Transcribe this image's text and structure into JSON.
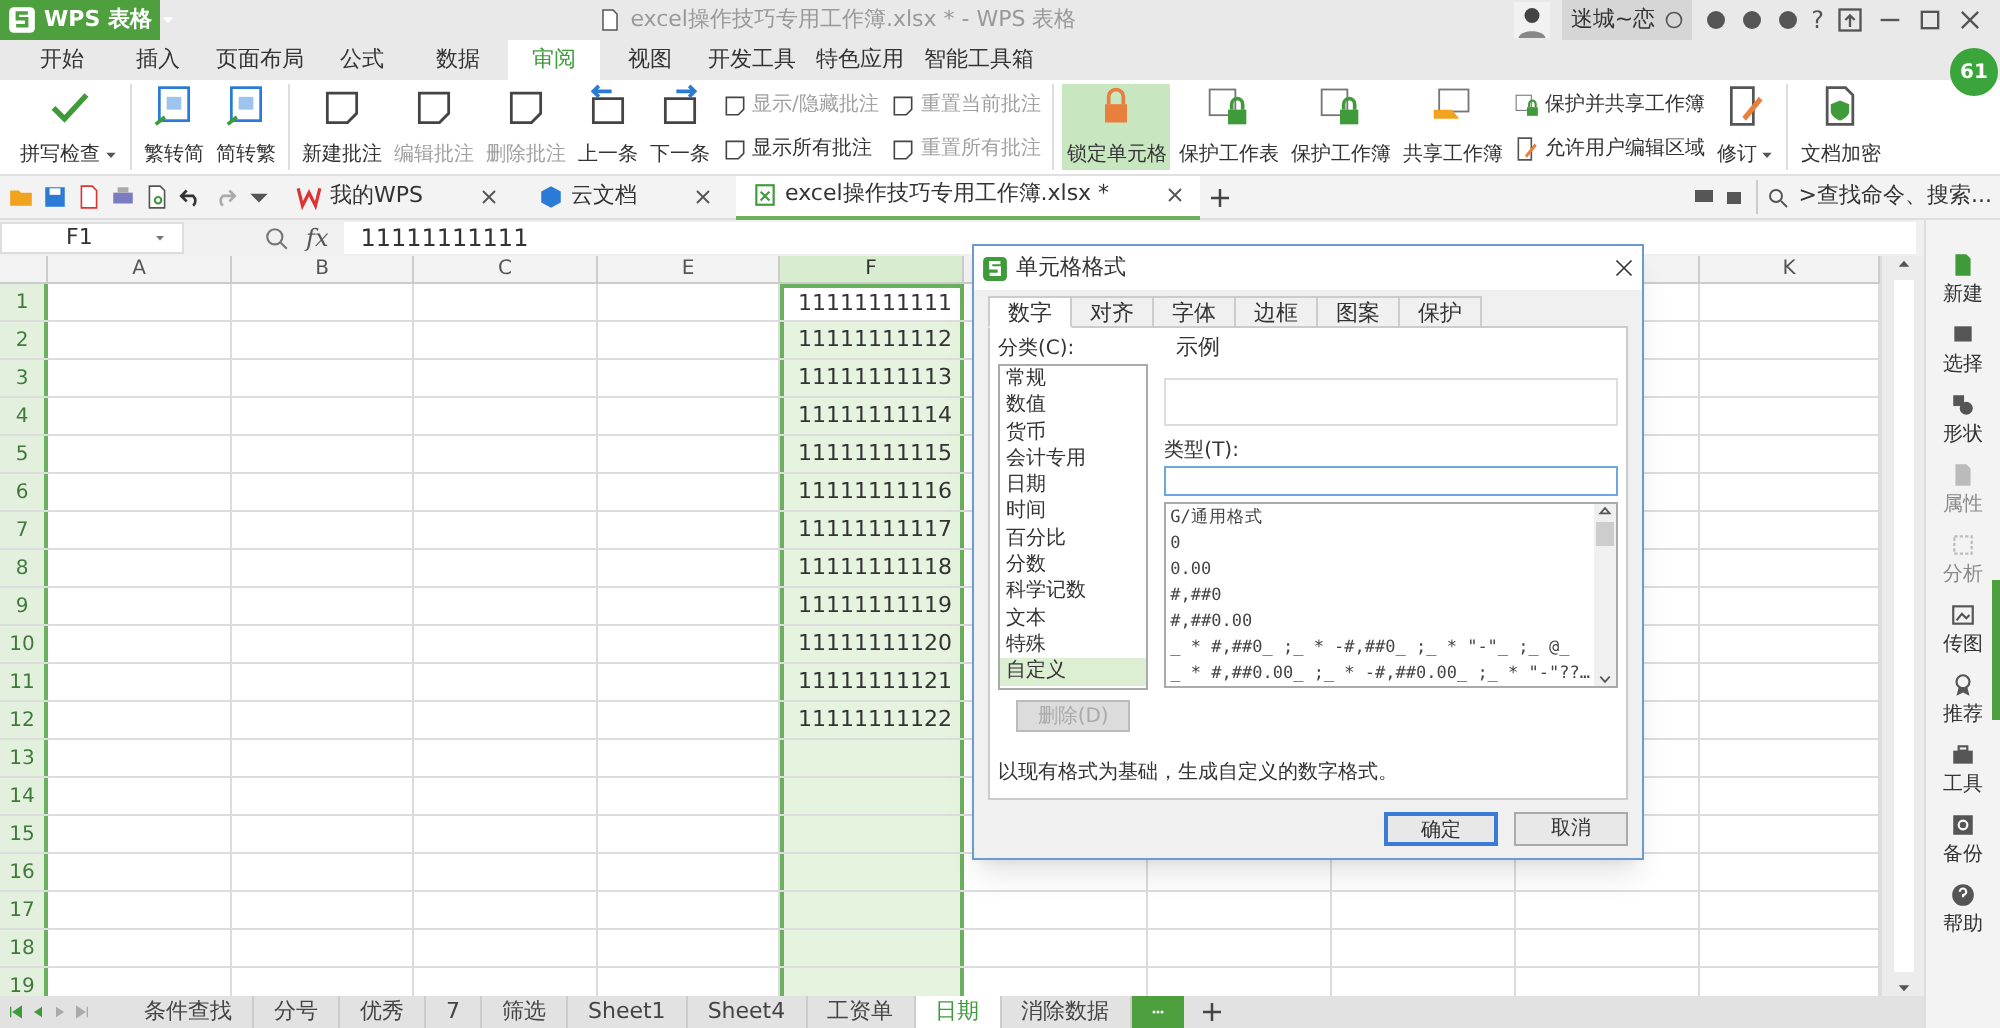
{
  "app_button": {
    "label": "WPS 表格"
  },
  "window": {
    "title": "excel操作技巧专用工作簿.xlsx * - WPS 表格"
  },
  "user": {
    "name": "迷城~恋",
    "help": "?"
  },
  "badge": {
    "text": "61"
  },
  "ribbon_tabs": [
    {
      "label": "开始",
      "selected": false
    },
    {
      "label": "插入",
      "selected": false
    },
    {
      "label": "页面布局",
      "selected": false
    },
    {
      "label": "公式",
      "selected": false
    },
    {
      "label": "数据",
      "selected": false
    },
    {
      "label": "审阅",
      "selected": true
    },
    {
      "label": "视图",
      "selected": false
    },
    {
      "label": "开发工具",
      "selected": false
    },
    {
      "label": "特色应用",
      "selected": false
    },
    {
      "label": "智能工具箱",
      "selected": false
    }
  ],
  "ribbon_groups": [
    {
      "items": [
        {
          "kind": "large",
          "label": "拼写检查",
          "dropdown": true,
          "disabled": false,
          "selected": false
        }
      ]
    },
    {
      "items": [
        {
          "kind": "large",
          "label": "繁转简",
          "disabled": false,
          "selected": false
        },
        {
          "kind": "large",
          "label": "简转繁",
          "disabled": false,
          "selected": false
        }
      ]
    },
    {
      "items": [
        {
          "kind": "large",
          "label": "新建批注",
          "disabled": false,
          "selected": false
        },
        {
          "kind": "large",
          "label": "编辑批注",
          "disabled": true,
          "selected": false
        },
        {
          "kind": "large",
          "label": "删除批注",
          "disabled": true,
          "selected": false
        },
        {
          "kind": "large",
          "label": "上一条",
          "disabled": false,
          "selected": false
        },
        {
          "kind": "large",
          "label": "下一条",
          "disabled": false,
          "selected": false
        },
        {
          "kind": "small",
          "label": "显示/隐藏批注",
          "disabled": true,
          "selected": false
        },
        {
          "kind": "small",
          "label": "显示所有批注",
          "disabled": false,
          "selected": false
        },
        {
          "kind": "small",
          "label": "重置当前批注",
          "disabled": true,
          "selected": false
        },
        {
          "kind": "small",
          "label": "重置所有批注",
          "disabled": true,
          "selected": false
        }
      ]
    },
    {
      "items": [
        {
          "kind": "large",
          "label": "锁定单元格",
          "disabled": false,
          "selected": true
        },
        {
          "kind": "large",
          "label": "保护工作表",
          "disabled": false,
          "selected": false
        },
        {
          "kind": "large",
          "label": "保护工作簿",
          "disabled": false,
          "selected": false
        },
        {
          "kind": "large",
          "label": "共享工作簿",
          "disabled": false,
          "selected": false
        },
        {
          "kind": "small",
          "label": "保护并共享工作簿",
          "disabled": false,
          "selected": false
        },
        {
          "kind": "small",
          "label": "允许用户编辑区域",
          "disabled": false,
          "selected": false
        },
        {
          "kind": "large",
          "label": "修订",
          "dropdown": true,
          "disabled": false,
          "selected": false
        }
      ]
    },
    {
      "items": [
        {
          "kind": "large",
          "label": "文档加密",
          "disabled": false,
          "selected": false
        }
      ]
    }
  ],
  "doc_tabs": [
    {
      "label": "我的WPS",
      "selected": false
    },
    {
      "label": "云文档",
      "selected": false
    },
    {
      "label": "excel操作技巧专用工作簿.xlsx *",
      "selected": true
    }
  ],
  "search": {
    "placeholder": ">查找命令、搜索..."
  },
  "formula_bar": {
    "name_box": "F1",
    "fx": "fx",
    "value": "11111111111"
  },
  "columns": [
    {
      "label": "A",
      "selected": false
    },
    {
      "label": "B",
      "selected": false
    },
    {
      "label": "C",
      "selected": false
    },
    {
      "label": "E",
      "selected": false
    },
    {
      "label": "F",
      "selected": true
    },
    {
      "label": "K",
      "selected": false
    }
  ],
  "rows": [
    {
      "header": "1",
      "column_f": "11111111111"
    },
    {
      "header": "2",
      "column_f": "11111111112"
    },
    {
      "header": "3",
      "column_f": "11111111113"
    },
    {
      "header": "4",
      "column_f": "11111111114"
    },
    {
      "header": "5",
      "column_f": "11111111115"
    },
    {
      "header": "6",
      "column_f": "11111111116"
    },
    {
      "header": "7",
      "column_f": "11111111117"
    },
    {
      "header": "8",
      "column_f": "11111111118"
    },
    {
      "header": "9",
      "column_f": "11111111119"
    },
    {
      "header": "10",
      "column_f": "11111111120"
    },
    {
      "header": "11",
      "column_f": "11111111121"
    },
    {
      "header": "12",
      "column_f": "11111111122"
    },
    {
      "header": "13"
    },
    {
      "header": "14"
    },
    {
      "header": "15"
    },
    {
      "header": "16"
    },
    {
      "header": "17"
    },
    {
      "header": "18"
    },
    {
      "header": "19"
    }
  ],
  "sheet_tabs": [
    {
      "label": "条件查找",
      "selected": false
    },
    {
      "label": "分号",
      "selected": false
    },
    {
      "label": "优秀",
      "selected": false
    },
    {
      "label": "7",
      "selected": false
    },
    {
      "label": "筛选",
      "selected": false
    },
    {
      "label": "Sheet1",
      "selected": false
    },
    {
      "label": "Sheet4",
      "selected": false
    },
    {
      "label": "工资单",
      "selected": false
    },
    {
      "label": "日期",
      "selected": true
    },
    {
      "label": "消除数据",
      "selected": false
    }
  ],
  "sidebar": [
    {
      "label": "新建",
      "disabled": false
    },
    {
      "label": "选择",
      "disabled": false
    },
    {
      "label": "形状",
      "disabled": false
    },
    {
      "label": "属性",
      "disabled": true
    },
    {
      "label": "分析",
      "disabled": true
    },
    {
      "label": "传图",
      "disabled": false
    },
    {
      "label": "推荐",
      "disabled": false
    },
    {
      "label": "工具",
      "disabled": false
    },
    {
      "label": "备份",
      "disabled": false
    },
    {
      "label": "帮助",
      "disabled": false
    }
  ],
  "dialog": {
    "title": "单元格格式",
    "tabs": [
      {
        "label": "数字",
        "selected": true
      },
      {
        "label": "对齐",
        "selected": false
      },
      {
        "label": "字体",
        "selected": false
      },
      {
        "label": "边框",
        "selected": false
      },
      {
        "label": "图案",
        "selected": false
      },
      {
        "label": "保护",
        "selected": false
      }
    ],
    "category_label": "分类(C):",
    "categories": [
      {
        "label": "常规",
        "selected": false
      },
      {
        "label": "数值",
        "selected": false
      },
      {
        "label": "货币",
        "selected": false
      },
      {
        "label": "会计专用",
        "selected": false
      },
      {
        "label": "日期",
        "selected": false
      },
      {
        "label": "时间",
        "selected": false
      },
      {
        "label": "百分比",
        "selected": false
      },
      {
        "label": "分数",
        "selected": false
      },
      {
        "label": "科学记数",
        "selected": false
      },
      {
        "label": "文本",
        "selected": false
      },
      {
        "label": "特殊",
        "selected": false
      },
      {
        "label": "自定义",
        "selected": true
      }
    ],
    "delete_button": {
      "label": "删除(D)",
      "disabled": true
    },
    "sample_label": "示例",
    "type_label": "类型(T):",
    "type_formats": [
      "G/通用格式",
      "0",
      "0.00",
      "#,##0",
      "#,##0.00",
      "_ * #,##0_ ;_ * -#,##0_ ;_ * \"-\"_ ;_ @_",
      "_ * #,##0.00_ ;_ * -#,##0.00_ ;_ * \"-\"??…"
    ],
    "description": "以现有格式为基础，生成自定义的数字格式。",
    "buttons": [
      {
        "label": "确定",
        "primary": true
      },
      {
        "label": "取消",
        "primary": false
      }
    ]
  }
}
